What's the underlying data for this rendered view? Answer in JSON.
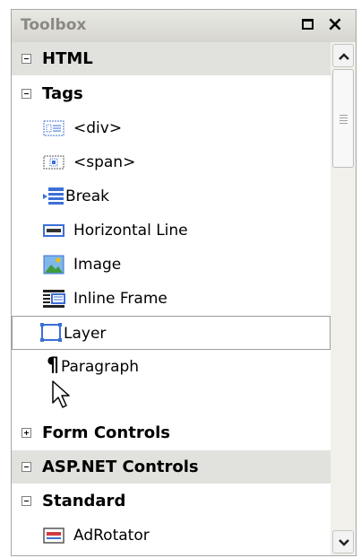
{
  "toolbox": {
    "title": "Toolbox",
    "maximize_icon": "maximize-icon",
    "close_icon": "close-icon"
  },
  "rows": {
    "html": "HTML",
    "tags": "Tags",
    "div": "<div>",
    "span": "<span>",
    "break": "Break",
    "horizontal_line": "Horizontal Line",
    "image": "Image",
    "inline_frame": "Inline Frame",
    "layer": "Layer",
    "paragraph": "Paragraph",
    "form_controls": "Form Controls",
    "asp_net_controls": "ASP.NET Controls",
    "standard": "Standard",
    "adrotator": "AdRotator"
  },
  "selected_item": "Layer",
  "colors": {
    "category_bg": "#e1e1dd",
    "title_text": "#8b8a82",
    "icon_blue": "#3b6fd6"
  }
}
